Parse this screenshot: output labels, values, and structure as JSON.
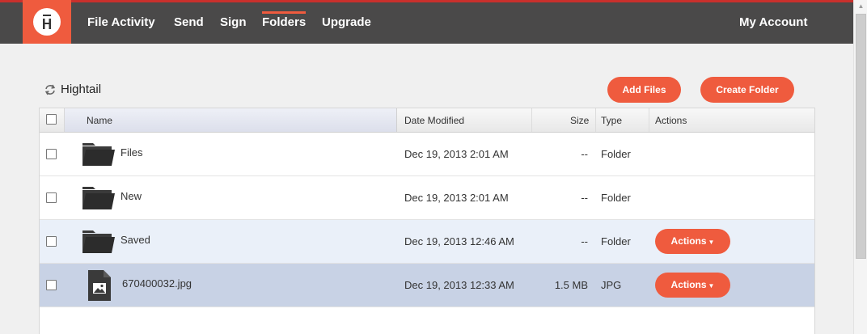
{
  "nav": {
    "items": [
      {
        "label": "File Activity",
        "active": false
      },
      {
        "label": "Send",
        "active": false
      },
      {
        "label": "Sign",
        "active": false
      },
      {
        "label": "Folders",
        "active": true
      },
      {
        "label": "Upgrade",
        "active": false
      }
    ],
    "account": "My Account"
  },
  "toolbar": {
    "breadcrumb": "Hightail",
    "add_files": "Add Files",
    "create_folder": "Create Folder"
  },
  "table": {
    "headers": {
      "name": "Name",
      "date": "Date Modified",
      "size": "Size",
      "type": "Type",
      "actions": "Actions"
    },
    "rows": [
      {
        "name": "Files",
        "date": "Dec 19, 2013 2:01 AM",
        "size": "--",
        "type": "Folder",
        "kind": "folder",
        "state": "normal",
        "actions": ""
      },
      {
        "name": "New",
        "date": "Dec 19, 2013 2:01 AM",
        "size": "--",
        "type": "Folder",
        "kind": "folder",
        "state": "normal",
        "actions": ""
      },
      {
        "name": "Saved",
        "date": "Dec 19, 2013 12:46 AM",
        "size": "--",
        "type": "Folder",
        "kind": "folder",
        "state": "hover",
        "actions": "Actions"
      },
      {
        "name": "670400032.jpg",
        "date": "Dec 19, 2013 12:33 AM",
        "size": "1.5 MB",
        "type": "JPG",
        "kind": "image",
        "state": "selected",
        "actions": "Actions"
      }
    ]
  },
  "colors": {
    "brand": "#ef5b3e",
    "topbar": "#4a4949",
    "row_hover": "#eaf0f9",
    "row_selected": "#c8d2e5"
  }
}
